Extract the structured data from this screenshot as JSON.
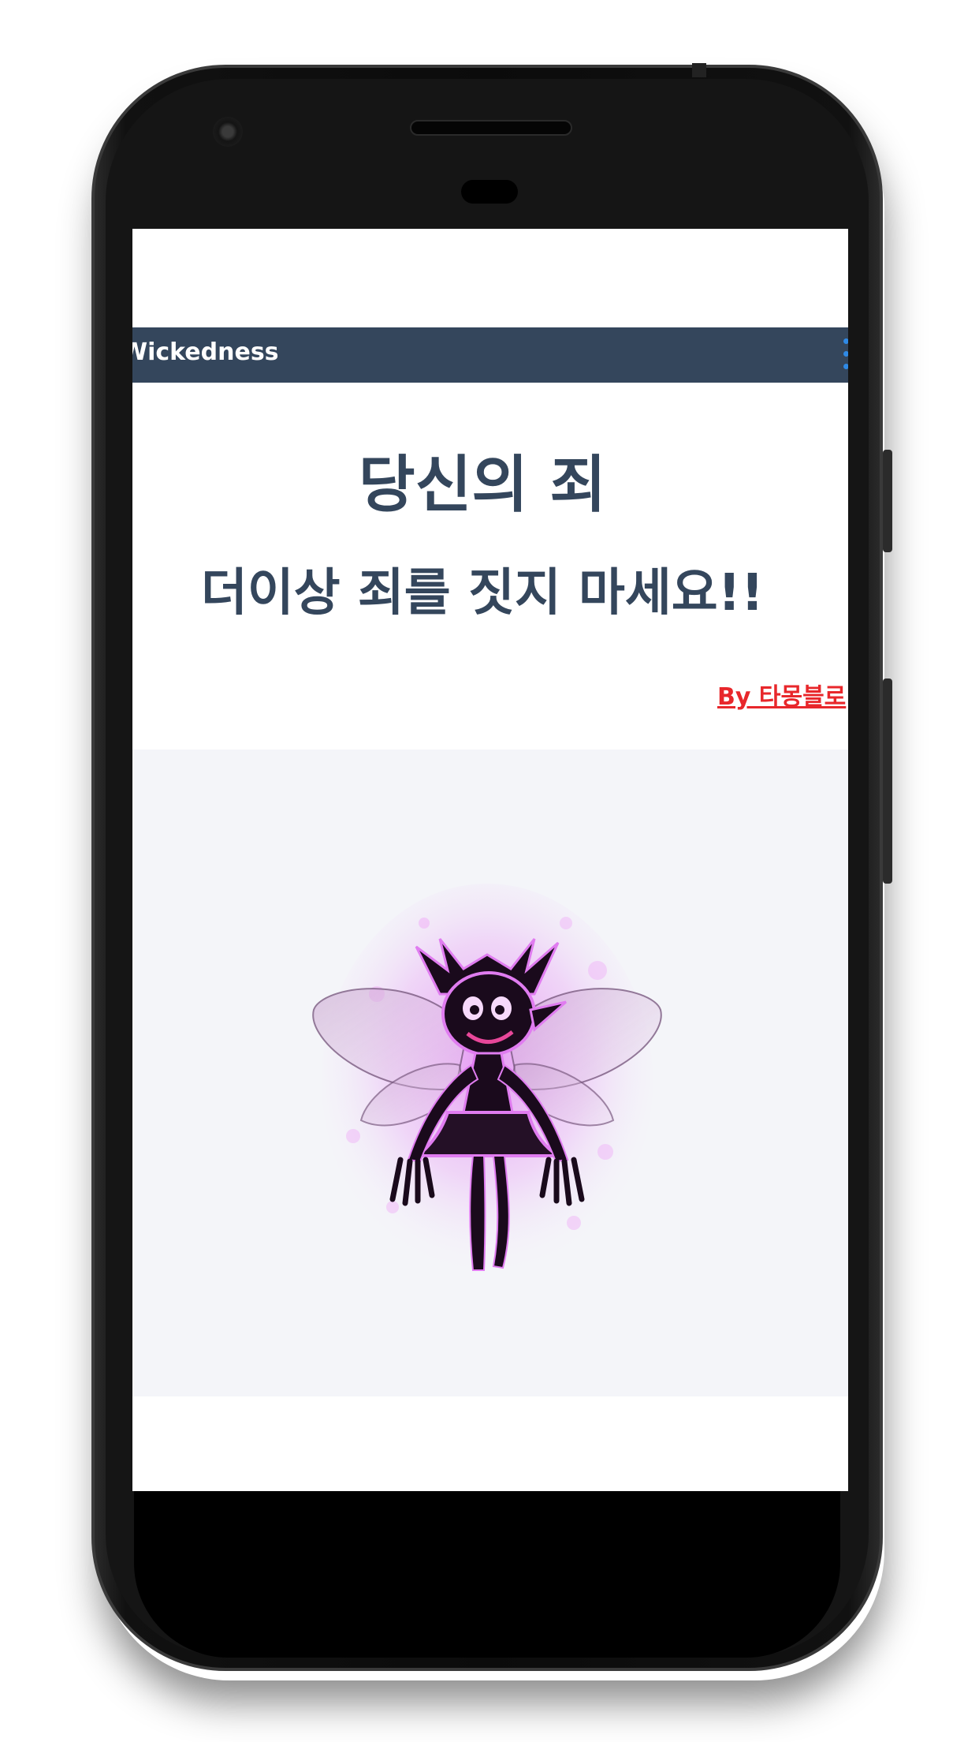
{
  "app": {
    "title": "Wickedness"
  },
  "content": {
    "headline": "당신의 죄",
    "subheadline": "더이상 죄를 짓지 마세요!!",
    "author_link": "By 타몽블로"
  },
  "illustration": {
    "subject": "dark fairy with pink glow and translucent wings",
    "glow_color": "#e07cf0",
    "body_color": "#1a0a1c"
  },
  "colors": {
    "appbar": "#34465c",
    "headline": "#34465c",
    "link": "#e8272b",
    "menu_dots": "#2f8ae6",
    "panel": "#f4f5f9"
  },
  "icons": {
    "menu": "overflow-menu-icon"
  }
}
